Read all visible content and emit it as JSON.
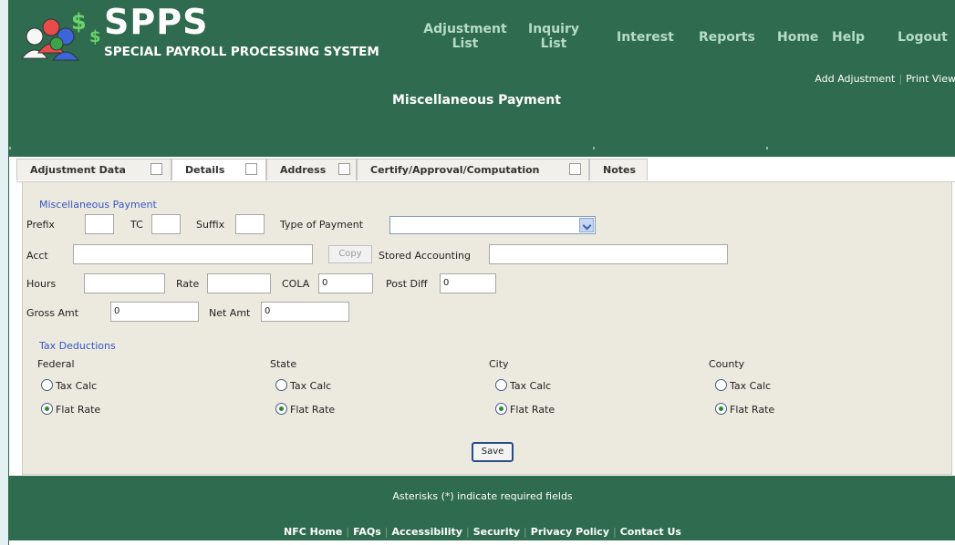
{
  "brand": {
    "title": "SPPS",
    "subtitle": "SPECIAL PAYROLL PROCESSING SYSTEM"
  },
  "nav": {
    "adjustment_list": [
      "Adjustment",
      "List"
    ],
    "inquiry_list": [
      "Inquiry",
      "List"
    ],
    "interest": "Interest",
    "reports": "Reports",
    "home": "Home",
    "help": "Help",
    "logout": "Logout"
  },
  "subnav": {
    "add_adjustment": "Add Adjustment",
    "print_view": "Print View"
  },
  "page_title": "Miscellaneous Payment",
  "tabs": [
    {
      "label": "Adjustment Data"
    },
    {
      "label": "Details"
    },
    {
      "label": "Address"
    },
    {
      "label": "Certify/Approval/Computation"
    },
    {
      "label": "Notes"
    }
  ],
  "form": {
    "section_title": "Miscellaneous Payment",
    "prefix_label": "Prefix",
    "tc_label": "TC",
    "suffix_label": "Suffix",
    "type_of_payment_label": "Type of Payment",
    "acct_label": "Acct",
    "copy_label": "Copy",
    "stored_accounting_label": "Stored Accounting",
    "hours_label": "Hours",
    "rate_label": "Rate",
    "cola_label": "COLA",
    "cola_value": "0",
    "post_diff_label": "Post Diff",
    "post_diff_value": "0",
    "gross_amt_label": "Gross Amt",
    "gross_amt_value": "0",
    "net_amt_label": "Net Amt",
    "net_amt_value": "0"
  },
  "tax": {
    "section_title": "Tax Deductions",
    "tax_calc_label": "Tax Calc",
    "flat_rate_label": "Flat Rate",
    "columns": [
      {
        "label": "Federal"
      },
      {
        "label": "State"
      },
      {
        "label": "City"
      },
      {
        "label": "County"
      }
    ]
  },
  "save_label": "Save",
  "footer": {
    "note": "Asterisks (*) indicate required fields",
    "links": [
      "NFC Home",
      "FAQs",
      "Accessibility",
      "Security",
      "Privacy Policy",
      "Contact Us"
    ]
  },
  "colors": {
    "header_bg": "#2f6b4e",
    "nav_text": "#b6dbc9",
    "section_blue": "#3657c7",
    "form_bg": "#ece9df"
  }
}
